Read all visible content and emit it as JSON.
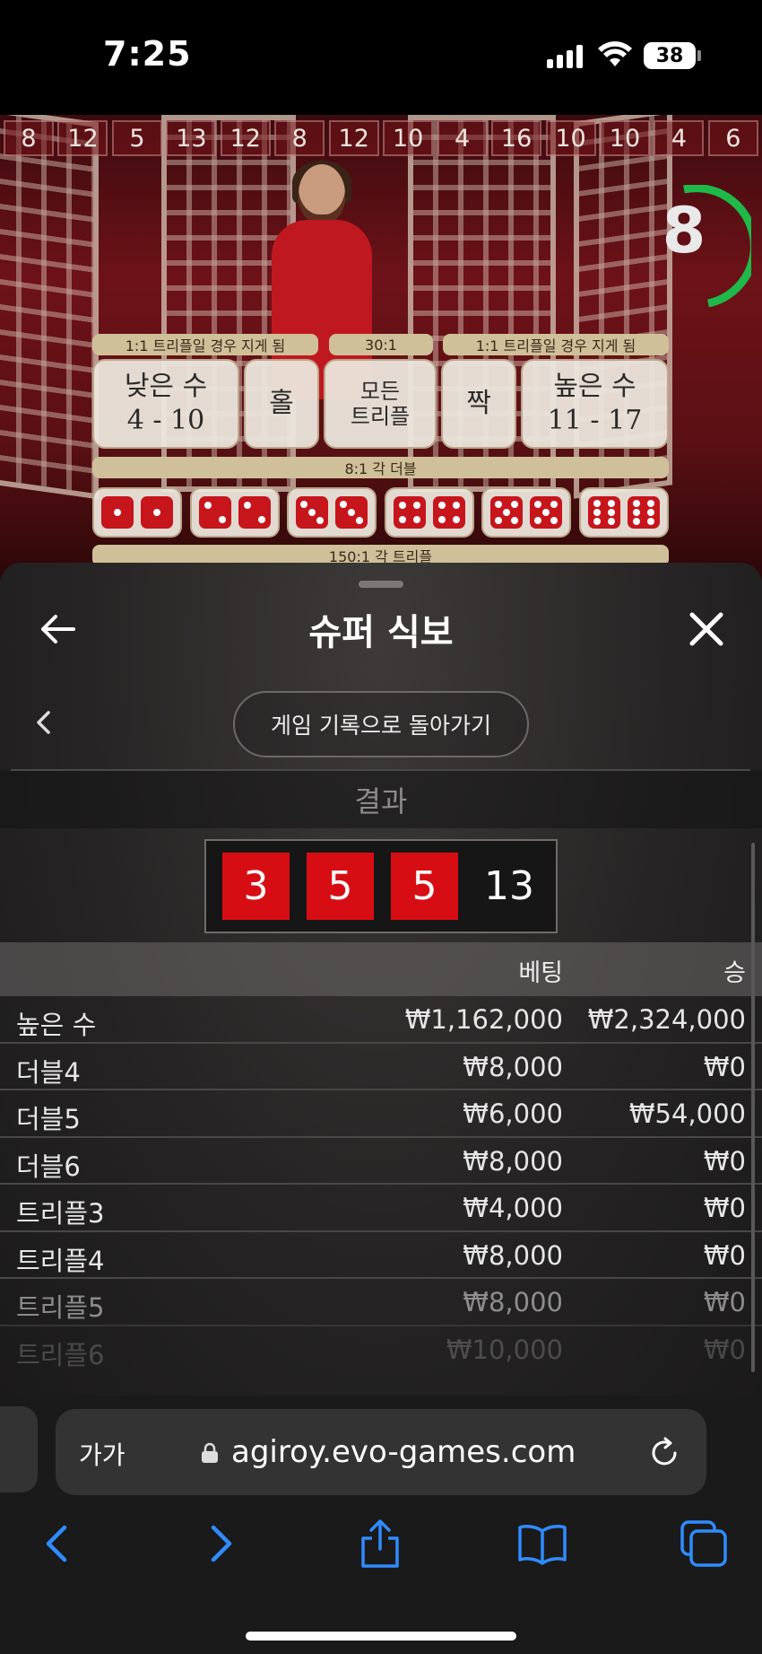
{
  "status_bar": {
    "time": "7:25",
    "battery": "38"
  },
  "game": {
    "history": [
      "8",
      "12",
      "5",
      "13",
      "12",
      "8",
      "12",
      "10",
      "4",
      "16",
      "10",
      "10",
      "4",
      "6"
    ],
    "timer": "8",
    "labels": {
      "left_loss": "1:1 트리플일 경우 지게 됨",
      "any_triple": "30:1",
      "right_loss": "1:1 트리플일 경우 지게 됨",
      "double": "8:1 각 더블",
      "triple": "150:1 각 트리플"
    },
    "cells": {
      "small": {
        "title": "낮은 수",
        "range": "4 - 10"
      },
      "odd": "홀",
      "any_triple_line1": "모든",
      "any_triple_line2": "트리플",
      "even": "짝",
      "big": {
        "title": "높은 수",
        "range": "11 - 17"
      }
    }
  },
  "sheet": {
    "title": "슈퍼 식보",
    "back_to_history": "게임 기록으로 돌아가기",
    "result_header": "결과",
    "result": {
      "dice": [
        "3",
        "5",
        "5"
      ],
      "sum": "13"
    },
    "table": {
      "header": {
        "bet": "베팅",
        "win": "승"
      },
      "rows": [
        {
          "name": "높은 수",
          "bet": "₩1,162,000",
          "win": "₩2,324,000"
        },
        {
          "name": "더블4",
          "bet": "₩8,000",
          "win": "₩0"
        },
        {
          "name": "더블5",
          "bet": "₩6,000",
          "win": "₩54,000"
        },
        {
          "name": "더블6",
          "bet": "₩8,000",
          "win": "₩0"
        },
        {
          "name": "트리플3",
          "bet": "₩4,000",
          "win": "₩0"
        },
        {
          "name": "트리플4",
          "bet": "₩8,000",
          "win": "₩0"
        },
        {
          "name": "트리플5",
          "bet": "₩8,000",
          "win": "₩0"
        },
        {
          "name": "트리플6",
          "bet": "₩10,000",
          "win": "₩0"
        }
      ]
    }
  },
  "browser": {
    "aa_label": "가가",
    "url": "agiroy.evo-games.com"
  },
  "colors": {
    "die_red": "#d60e14",
    "accent_blue": "#2f8cff",
    "timer_green": "#1fb84a"
  }
}
